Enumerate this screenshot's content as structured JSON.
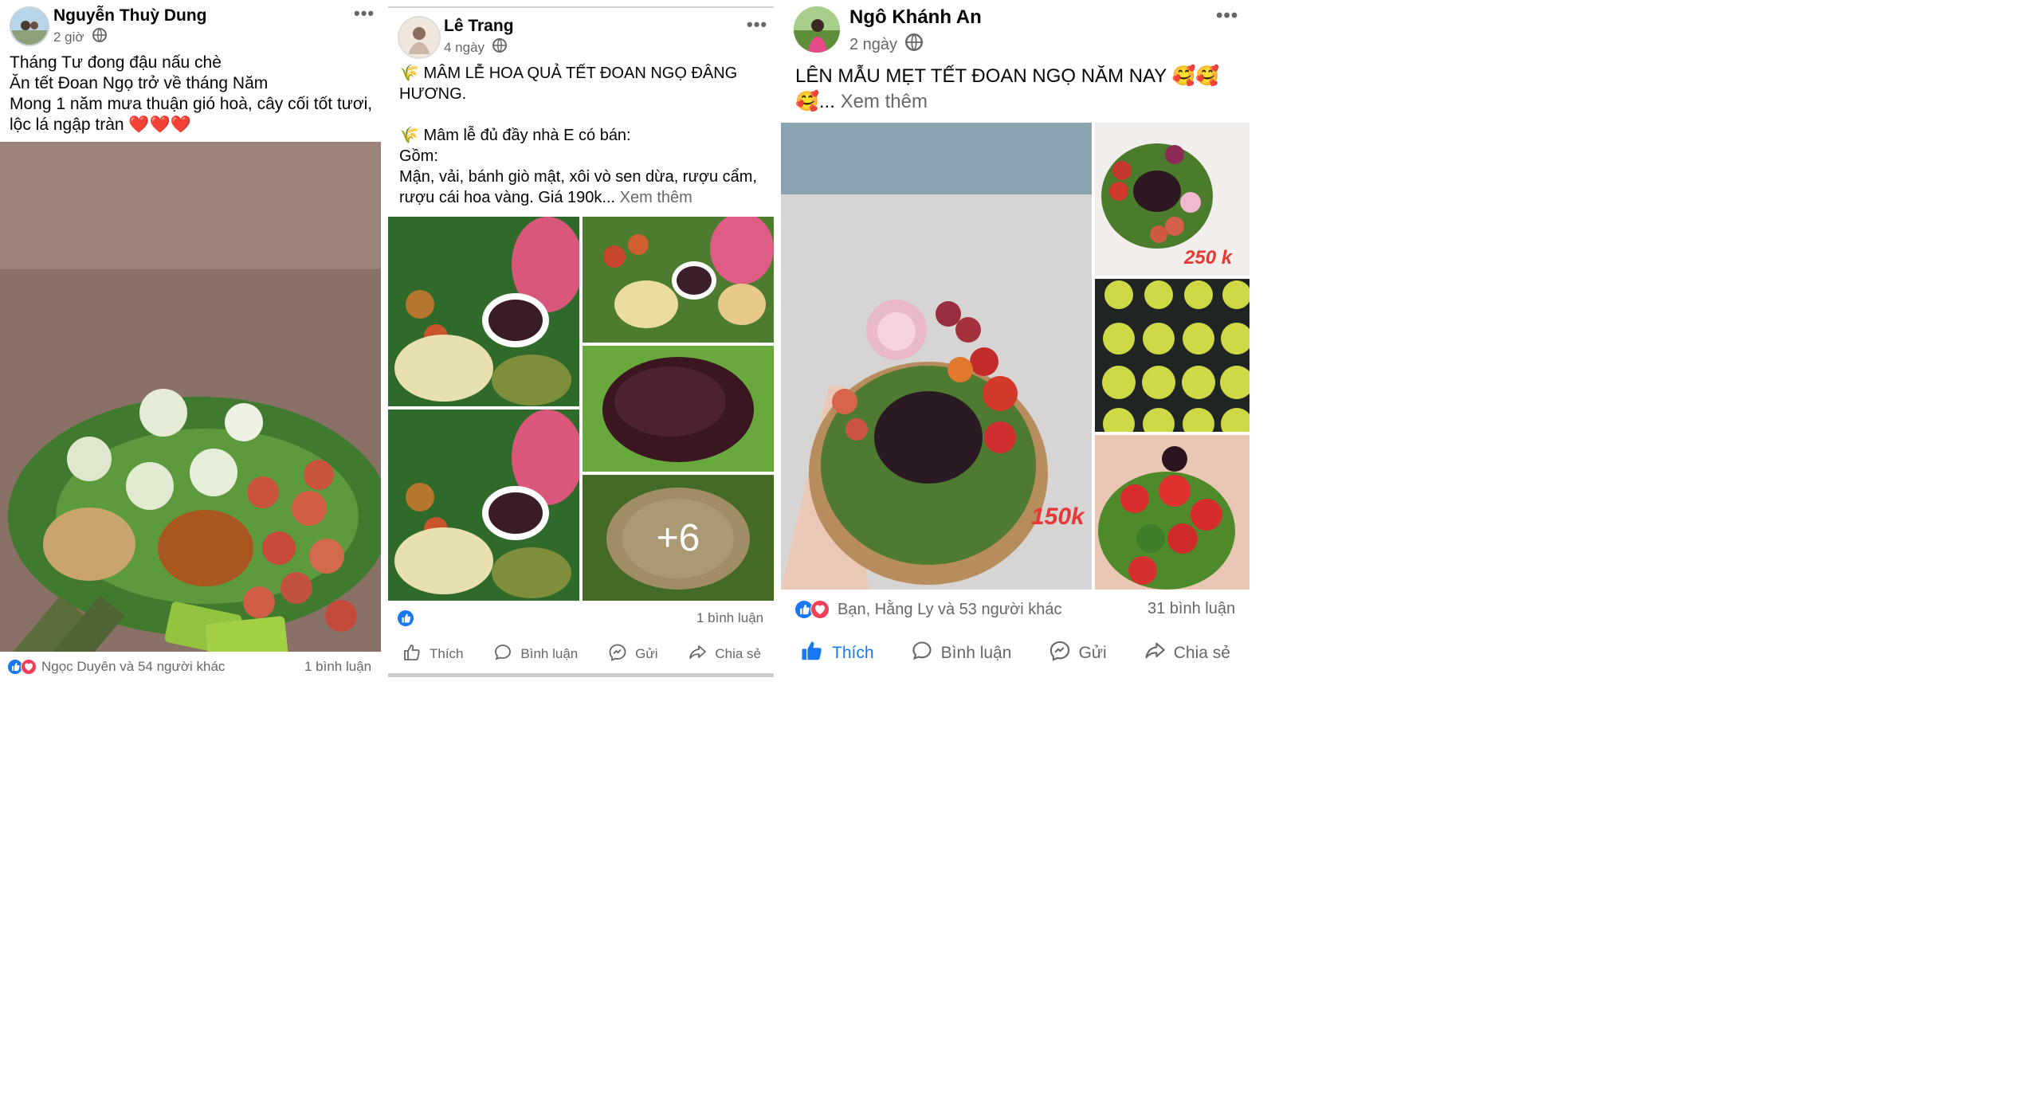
{
  "posts": [
    {
      "author": "Nguyễn Thuỳ Dung",
      "time": "2 giờ",
      "lines": [
        "Tháng Tư đong đậu nấu chè",
        "Ăn tết Đoan Ngọ trở về tháng Năm",
        "Mong 1 năm mưa thuận gió hoà, cây cối tốt tươi,",
        "lộc lá ngập tràn ❤️❤️❤️"
      ],
      "reactions_text": "Ngọc Duyên và 54 người khác",
      "comments": "1 bình luận"
    },
    {
      "author": "Lê Trang",
      "time": "4 ngày",
      "lines": [
        "🌾 MÂM LỄ HOA QUẢ TẾT ĐOAN NGỌ ĐÂNG",
        "HƯƠNG.",
        "",
        "🌾 Mâm lễ đủ đầy nhà E có bán:",
        "Gồm:",
        "Mận, vải, bánh giò mật, xôi vò sen dừa, rượu cẩm,",
        "rượu cái hoa vàng. Giá 190k..."
      ],
      "see_more": "Xem thêm",
      "more_photos": "+6",
      "comments": "1 bình luận",
      "actions": [
        "Thích",
        "Bình luận",
        "Gửi",
        "Chia sẻ"
      ]
    },
    {
      "author": "Ngô Khánh An",
      "time": "2 ngày",
      "line1": "LÊN MẪU MẸT TẾT ĐOAN NGỌ NĂM NAY 🥰🥰",
      "line2": "🥰...",
      "see_more": "Xem thêm",
      "price_main": "150k",
      "price_side": "250 k",
      "reactions_text": "Bạn, Hằng Ly và 53 người khác",
      "comments": "31 bình luận",
      "actions": [
        "Thích",
        "Bình luận",
        "Gửi",
        "Chia sẻ"
      ]
    }
  ],
  "colors": {
    "like_blue": "#1877f2",
    "love_red": "#f33e58",
    "meta_gray": "#65676b"
  }
}
